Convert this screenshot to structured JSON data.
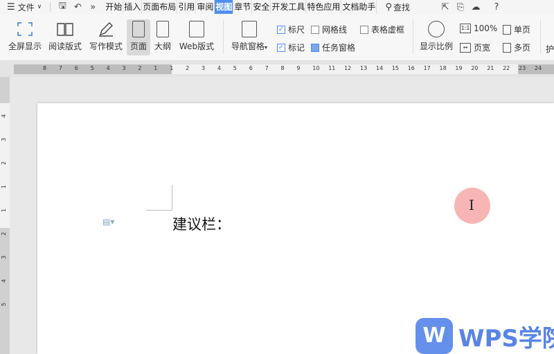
{
  "menubar": {
    "file_label": "文件",
    "tabs": [
      "开始",
      "插入",
      "页面布局",
      "引用",
      "审阅",
      "视图",
      "章节",
      "安全",
      "开发工具",
      "特色应用",
      "文档助手"
    ],
    "active_tab": "视图",
    "search_label": "查找"
  },
  "ribbon": {
    "fullscreen": "全屏显示",
    "read_mode": "阅读版式",
    "write_mode": "写作模式",
    "page": "页面",
    "outline": "大纲",
    "web": "Web版式",
    "nav_pane": "导航窗格",
    "ruler": "标尺",
    "gridlines": "网格线",
    "table_dashed": "表格虚框",
    "markup": "标记",
    "task_pane": "任务窗格",
    "zoom": "显示比例",
    "zoom_100": "100%",
    "page_width": "页宽",
    "single_page": "单页",
    "multi_page": "多页",
    "protect": "护"
  },
  "ruler": {
    "h_ticks": [
      "8",
      "7",
      "6",
      "5",
      "4",
      "3",
      "2",
      "1",
      "1",
      "2",
      "3",
      "4",
      "5",
      "6",
      "7",
      "8",
      "9",
      "10",
      "11",
      "12",
      "13",
      "14",
      "15",
      "16",
      "17",
      "18",
      "19",
      "20",
      "21",
      "22",
      "23",
      "24"
    ],
    "v_ticks": [
      "4",
      "3",
      "2",
      "1",
      "1",
      "2",
      "3",
      "4",
      "5"
    ]
  },
  "document": {
    "text": "建议栏："
  },
  "watermark": {
    "logo_letter": "W",
    "brand": "WPS学院"
  }
}
